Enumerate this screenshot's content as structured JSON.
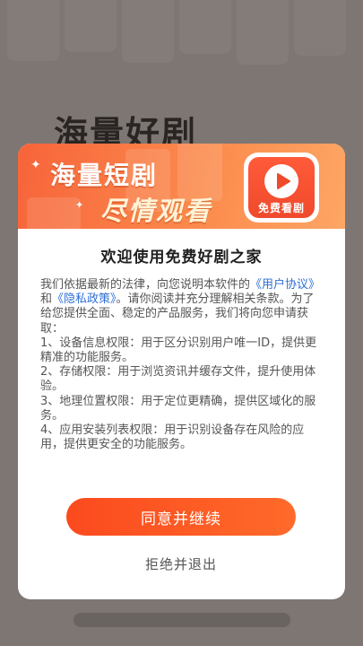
{
  "background": {
    "title": "海量好剧"
  },
  "dialog": {
    "banner": {
      "line1": "海量短剧",
      "line2": "尽情观看",
      "logo_caption": "免费看剧"
    },
    "title": "欢迎使用免费好剧之家",
    "body": {
      "intro_1": "我们依据最新的法律，向您说明本软件的",
      "user_agreement_link": "《用户协议》",
      "and": "和",
      "privacy_policy_link": "《隐私政策》",
      "intro_2": "。请你阅读并充分理解相关条款。为了给您提供全面、稳定的产品服务，我们将向您申请获取：",
      "items": [
        "1、设备信息权限：用于区分识别用户唯一ID，提供更精准的功能服务。",
        "2、存储权限：用于浏览资讯并缓存文件，提升使用体验。",
        "3、地理位置权限：用于定位更精确，提供区域化的服务。",
        "4、应用安装列表权限：用于识别设备存在风险的应用，提供更安全的功能服务。"
      ]
    },
    "agree_button": "同意并继续",
    "refuse_button": "拒绝并退出"
  },
  "colors": {
    "accent": "#fb4a1e",
    "link": "#2f6fd6",
    "banner_start": "#f7643a",
    "banner_end": "#fda664"
  }
}
